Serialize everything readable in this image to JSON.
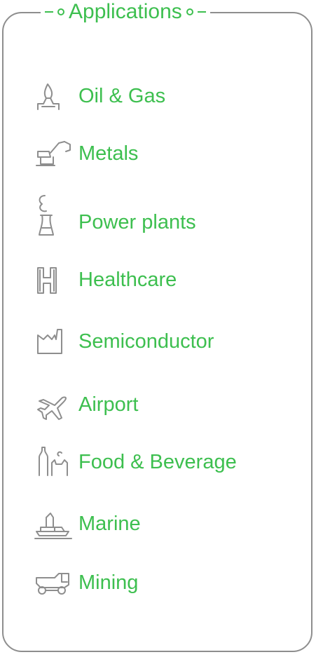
{
  "header": {
    "title": "Applications"
  },
  "colors": {
    "accent": "#3dbf4f",
    "icon": "#8e8e8e",
    "border": "#8e8e8e"
  },
  "applications": [
    {
      "label": "Oil & Gas",
      "icon": "gas-flare-icon"
    },
    {
      "label": "Metals",
      "icon": "excavator-icon"
    },
    {
      "label": "Power plants",
      "icon": "cooling-tower-icon"
    },
    {
      "label": "Healthcare",
      "icon": "hospital-icon"
    },
    {
      "label": "Semiconductor",
      "icon": "factory-icon"
    },
    {
      "label": "Airport",
      "icon": "airplane-icon"
    },
    {
      "label": "Food & Beverage",
      "icon": "bottle-icon"
    },
    {
      "label": "Marine",
      "icon": "ship-icon"
    },
    {
      "label": "Mining",
      "icon": "mining-truck-icon"
    }
  ]
}
